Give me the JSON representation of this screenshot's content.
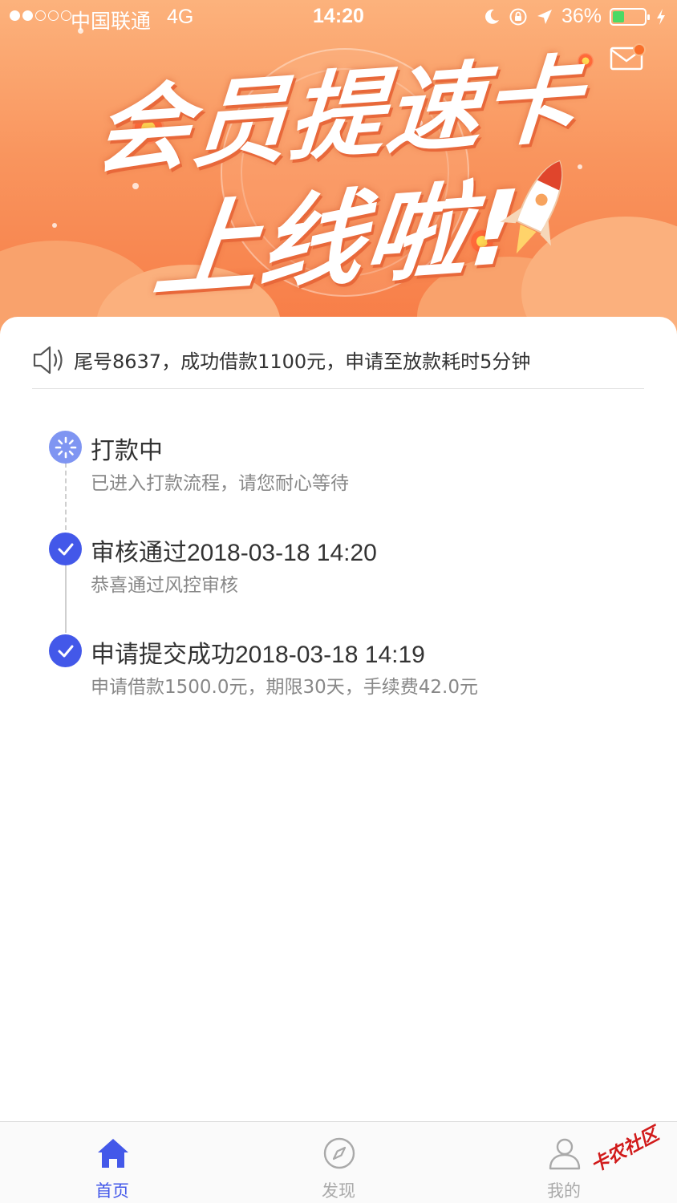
{
  "status_bar": {
    "carrier": "中国联通",
    "network": "4G",
    "time": "14:20",
    "battery_percent": "36%",
    "battery_level": 0.36
  },
  "banner": {
    "title_line1": "会员提速卡",
    "title_line2": "上线啦!"
  },
  "notice": {
    "text": "尾号8637，成功借款1100元，申请至放款耗时5分钟"
  },
  "timeline": [
    {
      "title": "打款中",
      "desc": "已进入打款流程，请您耐心等待",
      "status": "processing"
    },
    {
      "title": "审核通过2018-03-18 14:20",
      "desc": "恭喜通过风控审核",
      "status": "done"
    },
    {
      "title": "申请提交成功2018-03-18 14:19",
      "desc": "申请借款1500.0元，期限30天，手续费42.0元",
      "status": "done"
    }
  ],
  "tabbar": {
    "home": "首页",
    "discover": "发现",
    "mine": "我的"
  },
  "watermark": "卡农社区",
  "colors": {
    "accent": "#4358e9",
    "banner_orange": "#f9955e",
    "notification_badge": "#f96f2a"
  }
}
